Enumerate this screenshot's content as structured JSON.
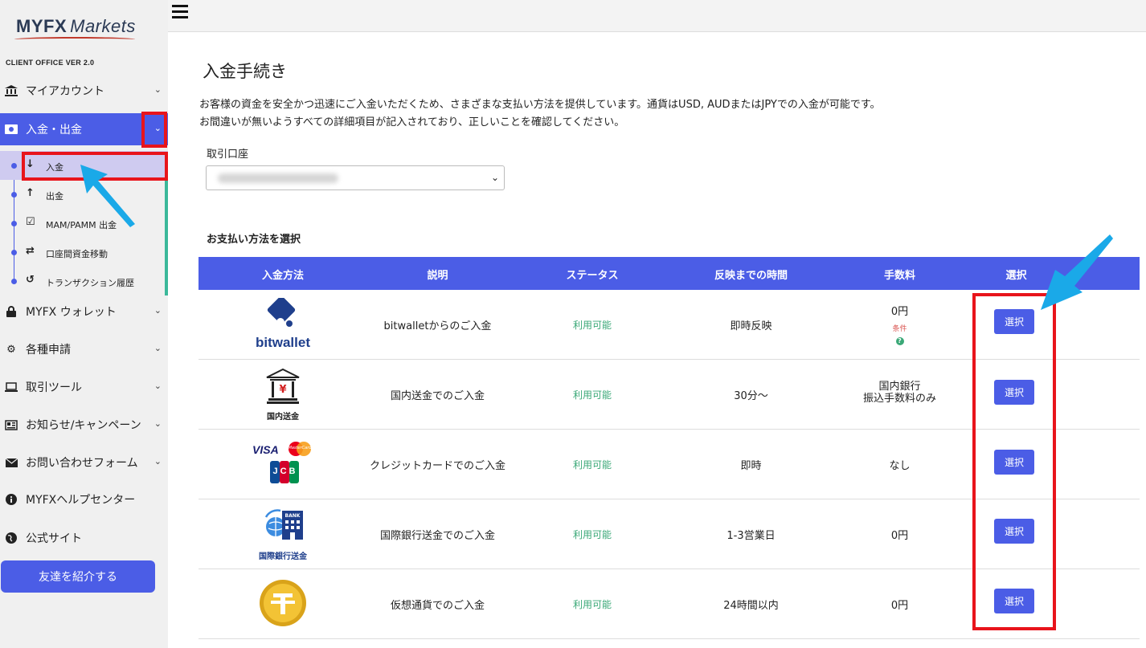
{
  "sidebar": {
    "logo": "MYFX Markets",
    "logo_word1": "MYFX",
    "logo_word2": "Markets",
    "version": "CLIENT OFFICE VER 2.0",
    "items": [
      {
        "label": "マイアカウント",
        "icon": "bank-icon"
      },
      {
        "label": "入金・出金",
        "icon": "money-icon"
      },
      {
        "label": "MYFX ウォレット",
        "icon": "lock-icon"
      },
      {
        "label": "各種申請",
        "icon": "gears-icon"
      },
      {
        "label": "取引ツール",
        "icon": "laptop-icon"
      },
      {
        "label": "お知らせ/キャンペーン",
        "icon": "newspaper-icon"
      },
      {
        "label": "お問い合わせフォーム",
        "icon": "envelope-icon"
      },
      {
        "label": "MYFXヘルプセンター",
        "icon": "info-icon"
      },
      {
        "label": "公式サイト",
        "icon": "globe-icon"
      }
    ],
    "subitems": [
      {
        "label": "入金",
        "icon": "arrow-down-icon"
      },
      {
        "label": "出金",
        "icon": "arrow-up-icon"
      },
      {
        "label": "MAM/PAMM 出金",
        "icon": "checkbox-icon"
      },
      {
        "label": "口座間資金移動",
        "icon": "transfer-icon"
      },
      {
        "label": "トランザクション履歴",
        "icon": "history-icon"
      }
    ],
    "invite_button": "友達を紹介する"
  },
  "page": {
    "title": "入金手続き",
    "desc_line1": "お客様の資金を安全かつ迅速にご入金いただくため、さまざまな支払い方法を提供しています。通貨はUSD, AUDまたはJPYでの入金が可能です。",
    "desc_line2": "お間違いが無いようすべての詳細項目が記入されており、正しいことを確認してください。",
    "account_label": "取引口座",
    "method_heading": "お支払い方法を選択"
  },
  "table": {
    "headers": [
      "入金方法",
      "説明",
      "ステータス",
      "反映までの時間",
      "手数料",
      "選択"
    ],
    "rows": [
      {
        "logo": "bitwallet",
        "desc": "bitwalletからのご入金",
        "status": "利用可能",
        "time": "即時反映",
        "fee": "0円",
        "fee_note": "条件",
        "button": "選択"
      },
      {
        "logo": "国内送金",
        "desc": "国内送金でのご入金",
        "status": "利用可能",
        "time": "30分〜",
        "fee": "国内銀行",
        "fee2": "振込手数料のみ",
        "button": "選択"
      },
      {
        "logo": "VISA",
        "logo_mc": "MasterCard",
        "logo_jcb": "JCB",
        "desc": "クレジットカードでのご入金",
        "status": "利用可能",
        "time": "即時",
        "fee": "なし",
        "button": "選択"
      },
      {
        "logo": "国際銀行送金",
        "logo_bank": "BANK",
        "desc": "国際銀行送金でのご入金",
        "status": "利用可能",
        "time": "1-3営業日",
        "fee": "0円",
        "button": "選択"
      },
      {
        "logo": "crypto-coin",
        "desc": "仮想通貨でのご入金",
        "status": "利用可能",
        "time": "24時間以内",
        "fee": "0円",
        "button": "選択"
      }
    ]
  },
  "colors": {
    "accent": "#4b5de6",
    "status_green": "#3aa877",
    "highlight_red": "#e8141b",
    "arrow_blue": "#1aa9e8"
  }
}
